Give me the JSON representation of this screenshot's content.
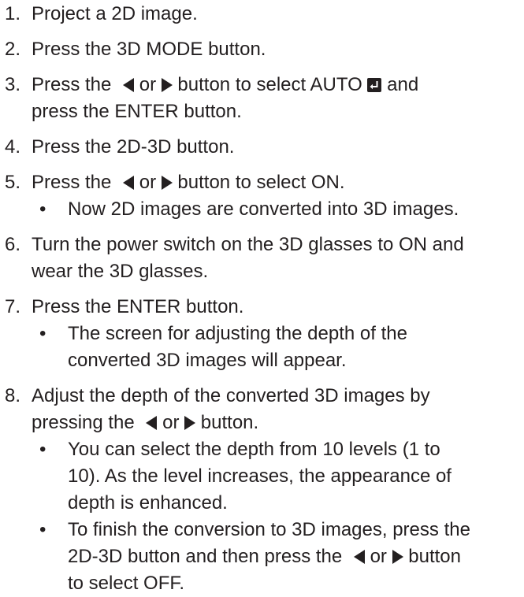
{
  "steps": [
    {
      "num": "1.",
      "text": "Project a 2D image."
    },
    {
      "num": "2.",
      "text": "Press the 3D MODE button."
    },
    {
      "num": "3.",
      "a": "Press the",
      "b": "or",
      "c": "button to select AUTO",
      "d": "and",
      "e": "press the ENTER button."
    },
    {
      "num": "4.",
      "text": "Press the 2D-3D button."
    },
    {
      "num": "5.",
      "a": "Press the",
      "b": "or",
      "c": "button to select ON."
    },
    {
      "num": "6.",
      "l1": "Turn the power switch on the 3D glasses to ON and",
      "l2": "wear the 3D glasses."
    },
    {
      "num": "7.",
      "text": "Press the ENTER button."
    },
    {
      "num": "8.",
      "l1": "Adjust the depth of the converted 3D images by",
      "a": "pressing the",
      "b": "or",
      "c": "button."
    }
  ],
  "bullets": {
    "b5": "Now 2D images are converted into 3D images.",
    "b7_l1": "The screen for adjusting the depth of the",
    "b7_l2": "converted 3D images will appear.",
    "b8a_l1": "You can select the depth from 10 levels (1 to",
    "b8a_l2": "10). As the level increases, the appearance of",
    "b8a_l3": "depth is enhanced.",
    "b8b_l1": "To finish the conversion to 3D images, press the",
    "b8b_l2a": "2D-3D button and then press the",
    "b8b_l2b": "or",
    "b8b_l2c": "button",
    "b8b_l3": "to select OFF."
  },
  "bullet_char": "•",
  "icons": {
    "left": "left-triangle-icon",
    "right": "right-triangle-icon",
    "enter": "enter-key-icon"
  }
}
